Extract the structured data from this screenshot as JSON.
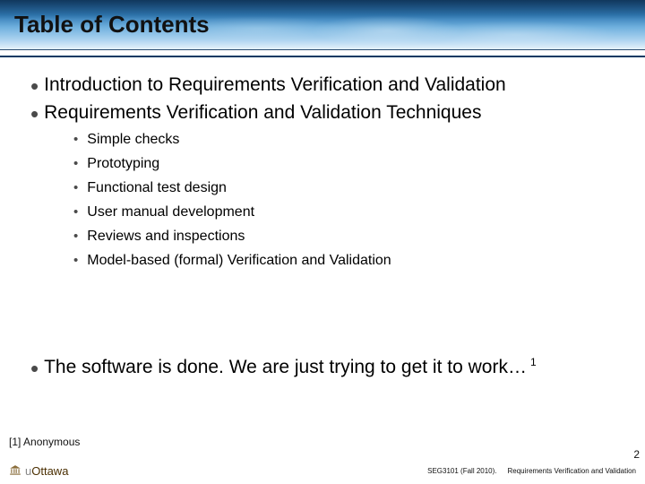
{
  "title": "Table of Contents",
  "main_bullets": {
    "intro": "Introduction to Requirements Verification and Validation",
    "techniques": "Requirements Verification and Validation Techniques",
    "quote": "The software is done. We are just trying to get it to work…",
    "quote_sup": "1"
  },
  "sub_bullets": [
    "Simple checks",
    "Prototyping",
    "Functional test design",
    "User manual development",
    "Reviews and inspections",
    "Model-based (formal) Verification and Validation"
  ],
  "citation": "[1] Anonymous",
  "footer": {
    "logo_prefix": "u",
    "logo_name": "Ottawa",
    "course": "SEG3101 (Fall 2010).",
    "topic": "Requirements Verification and Validation",
    "page": "2"
  }
}
